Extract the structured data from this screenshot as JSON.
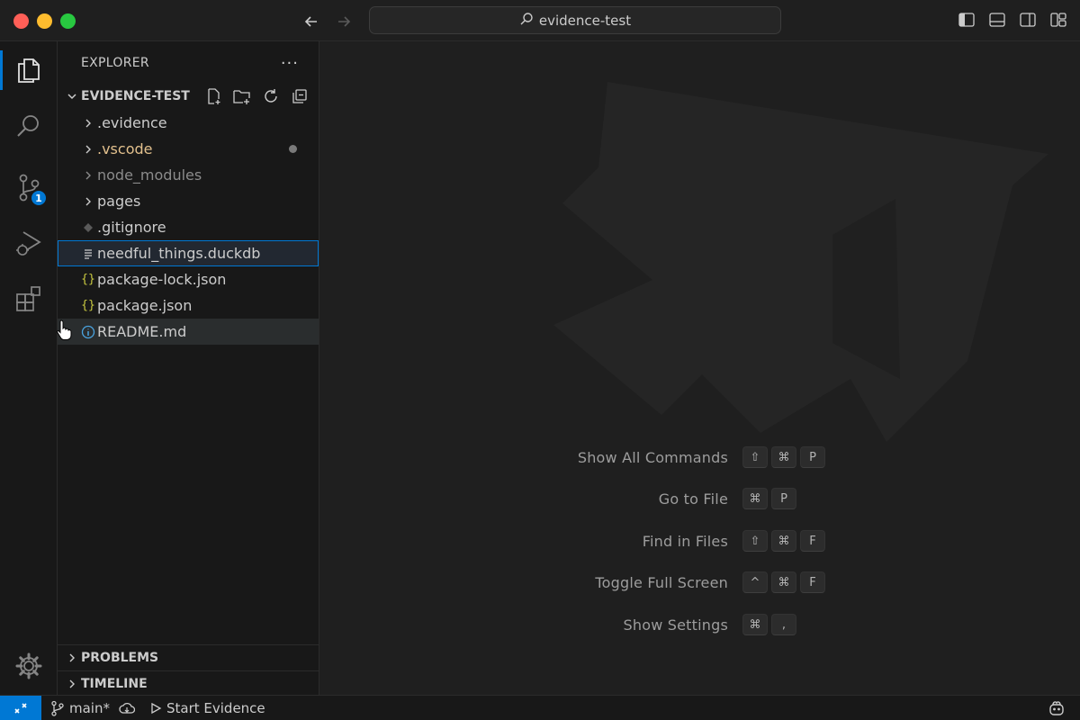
{
  "window": {
    "search_text": "evidence-test"
  },
  "activity": {
    "scm_badge": "1"
  },
  "explorer": {
    "header": "EXPLORER",
    "more": "···",
    "folder": "EVIDENCE-TEST",
    "items": [
      {
        "label": ".evidence",
        "type": "folder"
      },
      {
        "label": ".vscode",
        "type": "folder"
      },
      {
        "label": "node_modules",
        "type": "folder"
      },
      {
        "label": "pages",
        "type": "folder"
      },
      {
        "label": ".gitignore",
        "type": "file"
      },
      {
        "label": "needful_things.duckdb",
        "type": "file"
      },
      {
        "label": "package-lock.json",
        "type": "file"
      },
      {
        "label": "package.json",
        "type": "file"
      },
      {
        "label": "README.md",
        "type": "file"
      }
    ],
    "problems": "PROBLEMS",
    "timeline": "TIMELINE"
  },
  "shortcuts": [
    {
      "label": "Show All Commands",
      "keys": [
        "⇧",
        "⌘",
        "P"
      ]
    },
    {
      "label": "Go to File",
      "keys": [
        "⌘",
        "P"
      ]
    },
    {
      "label": "Find in Files",
      "keys": [
        "⇧",
        "⌘",
        "F"
      ]
    },
    {
      "label": "Toggle Full Screen",
      "keys": [
        "^",
        "⌘",
        "F"
      ]
    },
    {
      "label": "Show Settings",
      "keys": [
        "⌘",
        ","
      ]
    }
  ],
  "status": {
    "branch": "main*",
    "run": "Start Evidence"
  },
  "colors": {
    "accent": "#0078d4",
    "modified": "#e2c08d",
    "json_icon": "#cbcb41"
  }
}
